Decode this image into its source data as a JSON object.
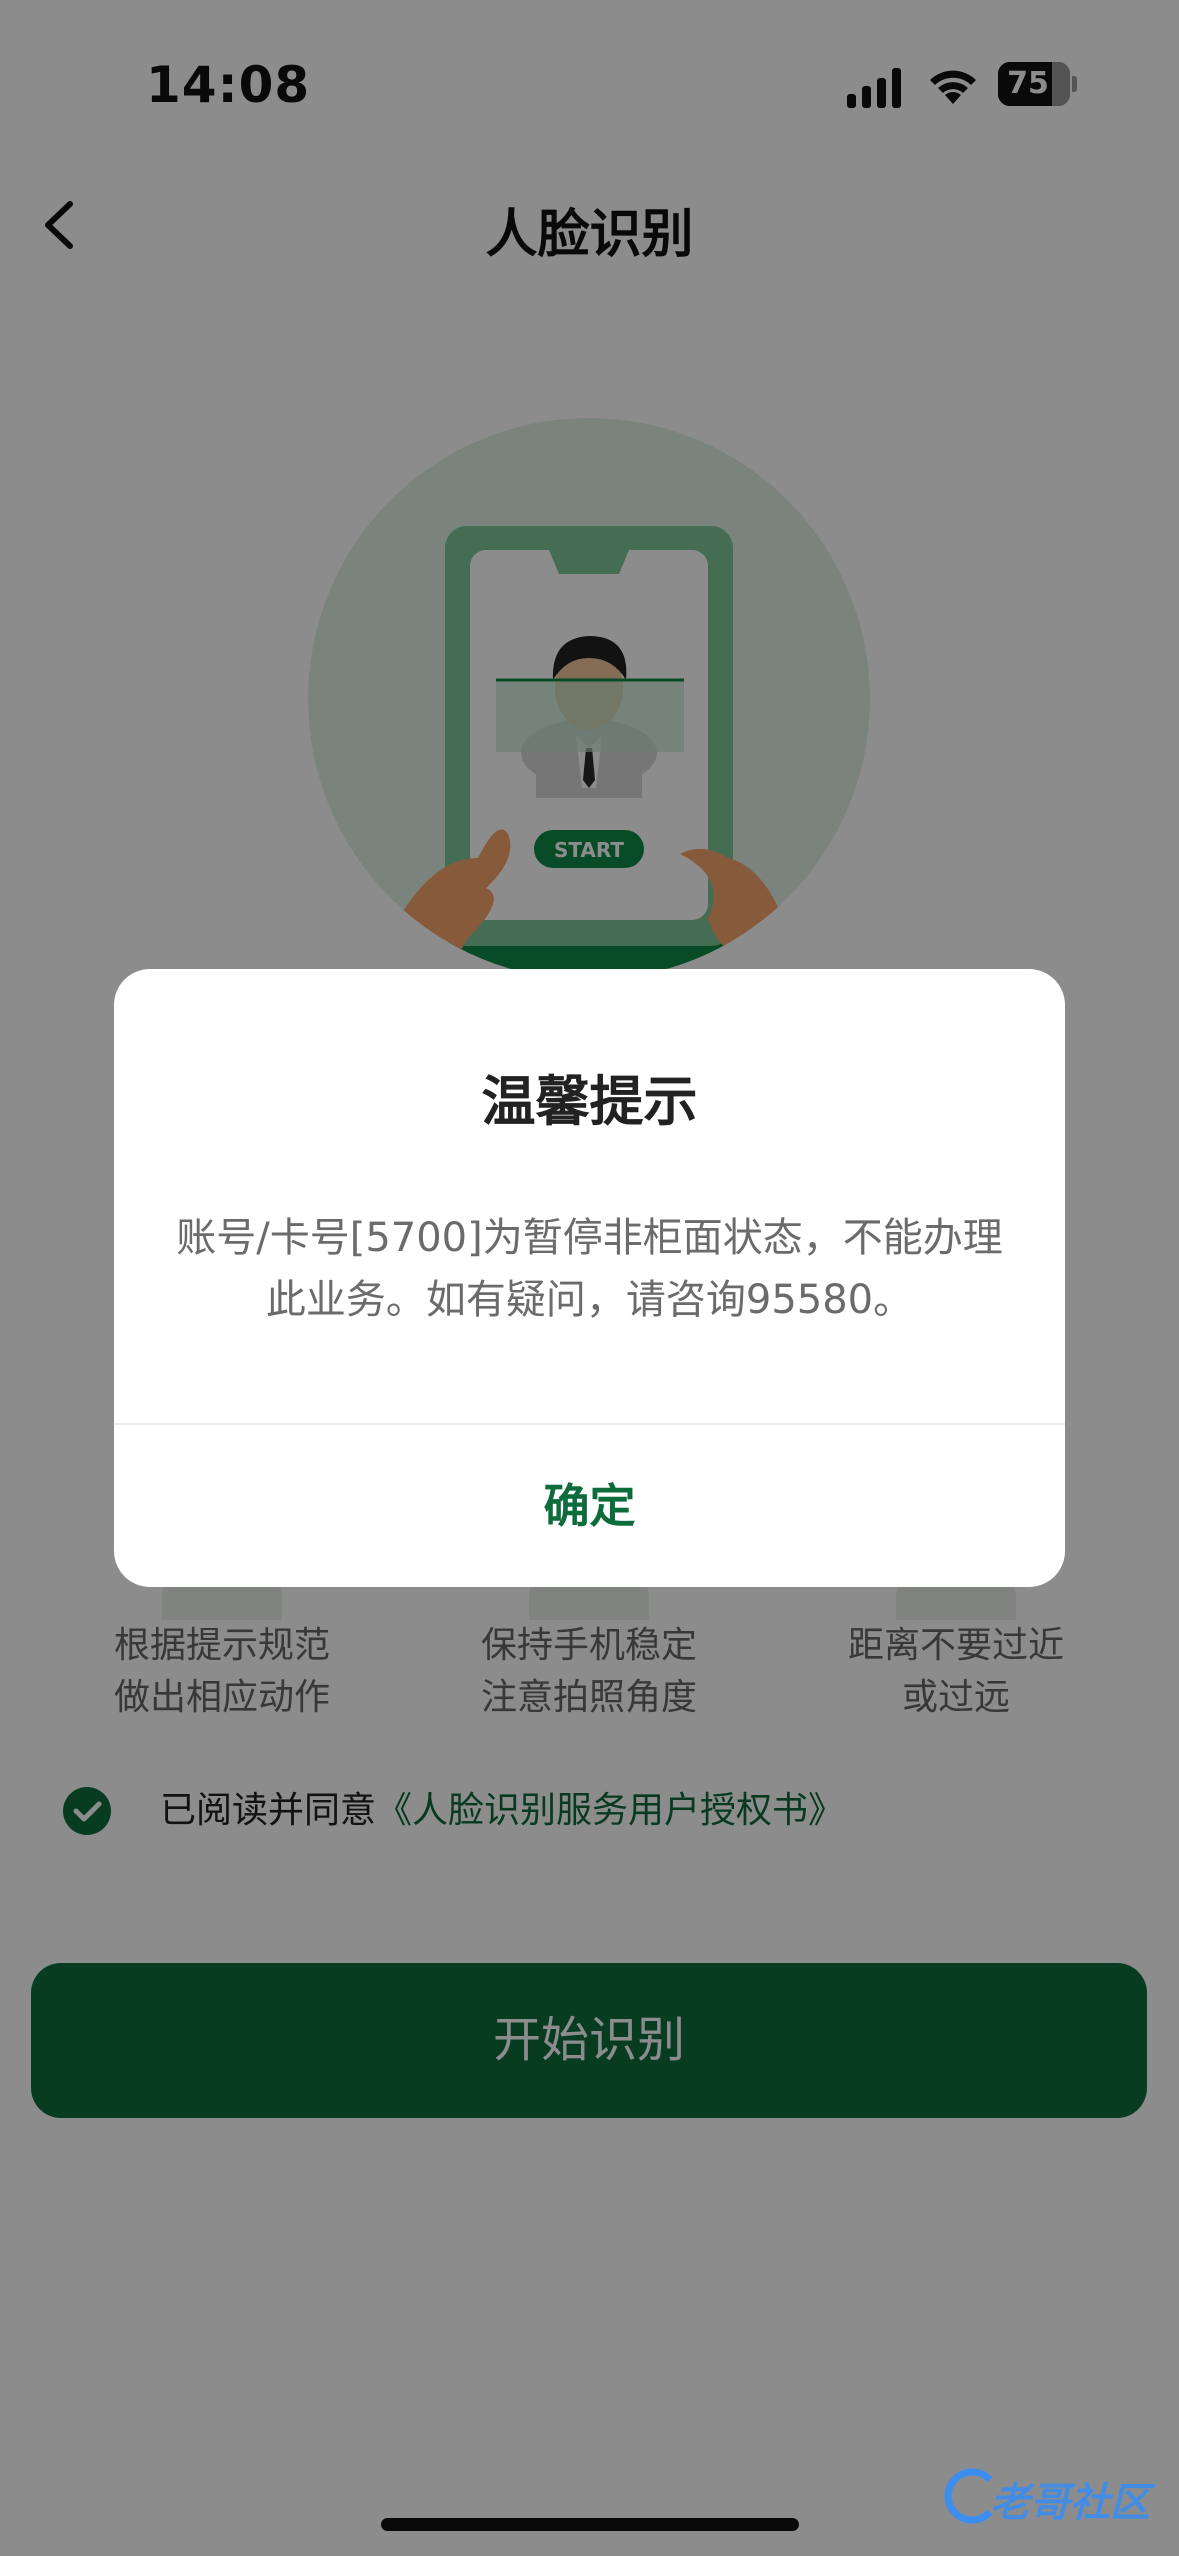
{
  "status_bar": {
    "time": "14:08",
    "battery_level": "75",
    "battery_fraction": 0.75
  },
  "nav": {
    "title": "人脸识别"
  },
  "illustration": {
    "start_label": "START"
  },
  "tips": [
    {
      "line1": "根据提示规范",
      "line2": "做出相应动作"
    },
    {
      "line1": "保持手机稳定",
      "line2": "注意拍照角度"
    },
    {
      "line1": "距离不要过近",
      "line2": "或过远"
    }
  ],
  "agreement": {
    "prefix": "已阅读并同意",
    "link": "《人脸识别服务用户授权书》",
    "checked": true
  },
  "start_button": {
    "label": "开始识别"
  },
  "dialog": {
    "title": "温馨提示",
    "message": "账号/卡号[5700]为暂停非柜面状态，不能办理此业务。如有疑问，请咨询95580。",
    "confirm_label": "确定"
  },
  "watermark": {
    "text": "老哥社区"
  },
  "colors": {
    "brand_green": "#0d6b3c",
    "overlay": "rgba(0,0,0,0.45)"
  }
}
